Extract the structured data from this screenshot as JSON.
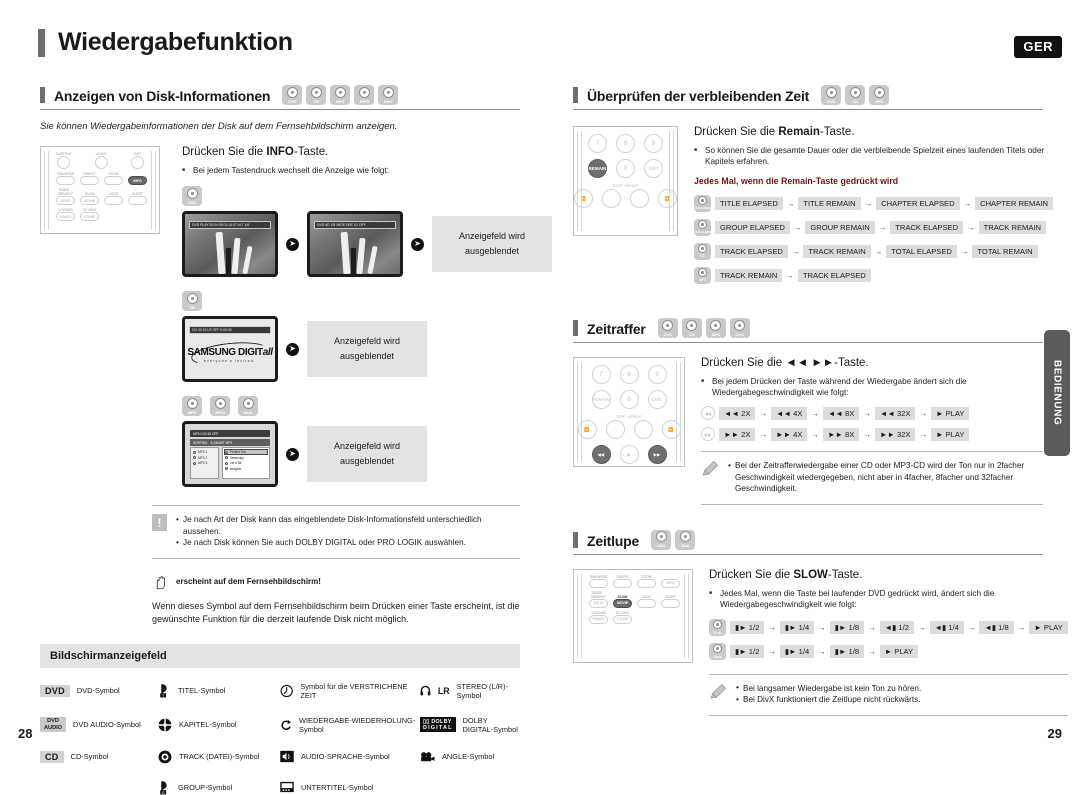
{
  "header": {
    "title": "Wiedergabefunktion",
    "lang_badge": "GER"
  },
  "side_tab": {
    "label": "BEDIENUNG"
  },
  "footer": {
    "page_left": "28",
    "page_right": "29"
  },
  "left_column": {
    "section": {
      "title": "Anzeigen von Disk-Informationen",
      "disc_icons": [
        "DVD",
        "CD",
        "MP3",
        "JPEG",
        "DivX"
      ],
      "intro": "Sie können Wiedergabeinformationen der Disk auf dem Fernsehbildschirm anzeigen."
    },
    "instruction": {
      "lead_pre": "Drücken Sie die ",
      "lead_key": "INFO",
      "lead_post": "-Taste.",
      "bullet": "Bei jedem Tastendruck wechselt die Anzeige wie folgt:"
    },
    "remote": {
      "labels": [
        "SUBTITLE",
        "AUDIO",
        "EXIT",
        "SUB MODE",
        "DIGEST",
        "ZOOM",
        "INFO",
        "TIMER/MEMORY",
        "SLOW",
        "LOGO",
        "SLEEP",
        "ECHO",
        "MOVIE",
        "V-SOUND",
        "EZ VIEW",
        "P.BASS",
        "VTUNE"
      ],
      "highlight": "INFO"
    },
    "rows": [
      {
        "disc": "DVD",
        "caption": "Anzeigefeld wird\nausgeblendet"
      },
      {
        "disc": "CD",
        "caption": "Anzeigefeld wird\nausgeblendet"
      },
      {
        "discs": [
          "MP3",
          "JPEG",
          "DivX"
        ],
        "caption": "Anzeigefeld wird\nausgeblendet"
      }
    ],
    "caption_line1": "Anzeigefeld wird",
    "caption_line2": "ausgeblendet",
    "osd_dvd_1": "DVD  PLAY  00:04:08  01:24:37  ALT 1/8",
    "osd_dvd_2": "DVD   AD 1/8  WIDE   DRC 02   OFF",
    "osd_cd": "CD  00:13  LR  OFF  0:00:00",
    "browser_top": "MP3   0:00:18   OFF",
    "browser_bar_label": "SORTING",
    "browser_bar_tag": "A-SMART MP3",
    "browser_left_items": [
      "MP3 1",
      "MP3 2",
      "MP3 3"
    ],
    "browser_right_items": [
      "Perfect You",
      "Yesterday",
      "Let It Be",
      "Imagine"
    ],
    "note": {
      "lines": [
        "Je nach Art der Disk kann das eingeblendete Disk-Informationsfeld unterschiedlich aussehen.",
        "Je nach Disk können Sie auch DOLBY DIGITAL oder PRO LOGIK auswählen."
      ]
    },
    "hand_note": {
      "label": "erscheint auf dem Fernsehbildschirm!",
      "paragraph": "Wenn dieses Symbol auf dem Fernsehbildschirm beim Drücken einer Taste erscheint, ist die gewünschte Funktion für die derzeit laufende Disk nicht möglich."
    },
    "legend": {
      "title": "Bildschirmanzeigefeld",
      "entries": [
        {
          "icon": "dvd-tag",
          "tag": "DVD",
          "label": "DVD-Symbol"
        },
        {
          "icon": "title-icon",
          "tag": "",
          "label": "TITEL-Symbol"
        },
        {
          "icon": "elapsed-icon",
          "tag": "",
          "label": "Symbol für die VERSTRICHENE ZEIT"
        },
        {
          "icon": "stereo-icon",
          "tag": "LR",
          "label": "STEREO (L/R)-Symbol"
        },
        {
          "icon": "dvd-audio-tag",
          "tag": "DVD AUDIO",
          "label": "DVD AUDIO-Symbol"
        },
        {
          "icon": "chapter-icon",
          "tag": "",
          "label": "KAPITEL-Symbol"
        },
        {
          "icon": "repeat-icon",
          "tag": "",
          "label": "WIEDERGABE-WIEDERHOLUNG-Symbol"
        },
        {
          "icon": "dolby-icon",
          "tag": "DOLBY DIGITAL",
          "label": "DOLBY DIGITAL-Symbol"
        },
        {
          "icon": "cd-tag",
          "tag": "CD",
          "label": "CD-Symbol"
        },
        {
          "icon": "track-icon",
          "tag": "",
          "label": "TRACK (DATEI)-Symbol"
        },
        {
          "icon": "audio-lang-icon",
          "tag": "",
          "label": "AUDIO-SPRACHE-Symbol"
        },
        {
          "icon": "angle-icon",
          "tag": "",
          "label": "ANGLE-Symbol"
        },
        {
          "icon": "",
          "tag": "",
          "label": ""
        },
        {
          "icon": "group-icon",
          "tag": "",
          "label": "GROUP-Symbol"
        },
        {
          "icon": "subtitle-icon",
          "tag": "",
          "label": "UNTERTITEL-Symbol"
        },
        {
          "icon": "",
          "tag": "",
          "label": ""
        }
      ]
    }
  },
  "right_column": {
    "remain": {
      "title": "Überprüfen der verbleibenden Zeit",
      "disc_icons": [
        "DVD",
        "CD",
        "MP3"
      ],
      "lead_pre": "Drücken Sie die ",
      "lead_key": "Remain",
      "lead_post": "-Taste.",
      "bullet": "So können Sie die gesamte Dauer oder die verbleibende Spielzeit eines laufenden Titels oder Kapitels erfahren.",
      "sub_heading": "Jedes Mal, wenn die Remain-Taste gedrückt wird",
      "keypad": {
        "keys": [
          "7",
          "8",
          "9",
          "REMAIN",
          "0",
          "DISC",
          "STEP",
          "REPEAT"
        ]
      },
      "sequences": [
        {
          "disc": "DVD-VIDEO",
          "steps": [
            "TITLE ELAPSED",
            "TITLE REMAIN",
            "CHAPTER ELAPSED",
            "CHAPTER REMAIN"
          ]
        },
        {
          "disc": "DVD-AUDIO",
          "steps": [
            "GROUP ELAPSED",
            "GROUP REMAIN",
            "TRACK ELAPSED",
            "TRACK REMAIN"
          ]
        },
        {
          "disc": "CD",
          "steps": [
            "TRACK ELAPSED",
            "TRACK REMAIN",
            "TOTAL ELAPSED",
            "TOTAL REMAIN"
          ]
        },
        {
          "disc": "MP3",
          "steps": [
            "TRACK REMAIN",
            "TRACK ELAPSED"
          ]
        }
      ]
    },
    "zeitraffer": {
      "title": "Zeitraffer",
      "disc_icons": [
        "DVD",
        "CD",
        "MP3",
        "DivX"
      ],
      "lead_pre": "Drücken Sie die ",
      "lead_key": "◄◄ ►►",
      "lead_post": "-Taste.",
      "bullet": "Bei jedem Drücken der Taste während der Wiedergabe ändert sich die Wiedergabegeschwindigkeit wie folgt:",
      "rows": [
        {
          "key": "rew",
          "steps": [
            "◄◄ 2X",
            "◄◄ 4X",
            "◄◄ 8X",
            "◄◄ 32X",
            "► PLAY"
          ]
        },
        {
          "key": "ff",
          "steps": [
            "►► 2X",
            "►► 4X",
            "►► 8X",
            "►► 32X",
            "► PLAY"
          ]
        }
      ],
      "note": {
        "lines": [
          "Bei der Zeitrafferwiedergabe einer CD oder MP3-CD wird der Ton nur in 2facher Geschwindigkeit wiedergegeben, nicht aber in 4facher, 8facher und 32facher Geschwindigkeit."
        ]
      },
      "keypad": {
        "keys": [
          "7",
          "8",
          "9",
          "REMAIN",
          "0",
          "DISC",
          "STEP",
          "REPEAT"
        ]
      }
    },
    "zeitlupe": {
      "title": "Zeitlupe",
      "disc_icons": [
        "DVD",
        "DivX"
      ],
      "lead_pre": "Drücken Sie die ",
      "lead_key": "SLOW",
      "lead_post": "-Taste.",
      "bullet": "Jedes Mal, wenn die Taste bei laufender DVD gedrückt wird, ändert sich die Wiedergabegeschwindigkeit wie folgt:",
      "rows": [
        {
          "disc": "DVD",
          "steps": [
            "▮► 1/2",
            "▮► 1/4",
            "▮► 1/8",
            "◄▮ 1/2",
            "◄▮ 1/4",
            "◄▮ 1/8",
            "► PLAY"
          ]
        },
        {
          "disc": "DivX",
          "steps": [
            "▮► 1/2",
            "▮► 1/4",
            "▮► 1/8",
            "► PLAY"
          ]
        }
      ],
      "note": {
        "lines": [
          "Bei langsamer Wiedergabe ist kein Ton zu hören.",
          "Bei DivX funktioniert die Zeitlupe nicht rückwärts."
        ]
      },
      "remote_labels": [
        "SUB MODE",
        "DIGEST",
        "ZOOM",
        "INFO",
        "TIMER/MEMORY",
        "SLOW",
        "LOGO",
        "SLEEP",
        "ECHO",
        "MOVIE",
        "V-SOUND",
        "EZ VIEW",
        "P.BASS",
        "VTUNE"
      ],
      "highlight": "SLOW"
    }
  }
}
